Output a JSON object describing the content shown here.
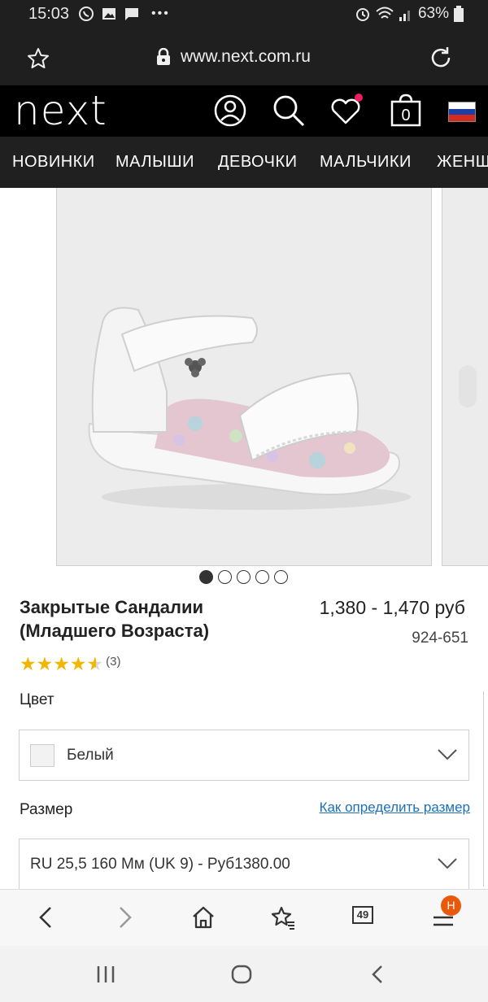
{
  "status_bar": {
    "time": "15:03",
    "battery": "63%",
    "more": "•••"
  },
  "browser": {
    "url": "www.next.com.ru",
    "tab_count": "49",
    "menu_badge": "H"
  },
  "header": {
    "logo": "next",
    "bag_count": "0"
  },
  "nav": {
    "items": [
      "НОВИНКИ",
      "МАЛЫШИ",
      "ДЕВОЧКИ",
      "МАЛЬЧИКИ",
      "ЖЕНЩ"
    ]
  },
  "gallery": {
    "slide_count": 5,
    "active_slide": 1
  },
  "product": {
    "title_line1": "Закрытые Сандалии",
    "title_line2": "(Младшего Возраста)",
    "price": "1,380 - 1,470 руб",
    "sku": "924-651",
    "rating": 4.5,
    "rating_count": "(3)"
  },
  "color": {
    "label": "Цвет",
    "selected": "Белый"
  },
  "size": {
    "label": "Размер",
    "guide_link": "Как определить размер",
    "selected": "RU 25,5 160 Мм (UK 9) - Руб1380.00"
  },
  "colors": {
    "accent_badge": "#e8590c",
    "notif_dot": "#e91e63",
    "link": "#1d6fb8",
    "star": "#f1b700"
  }
}
